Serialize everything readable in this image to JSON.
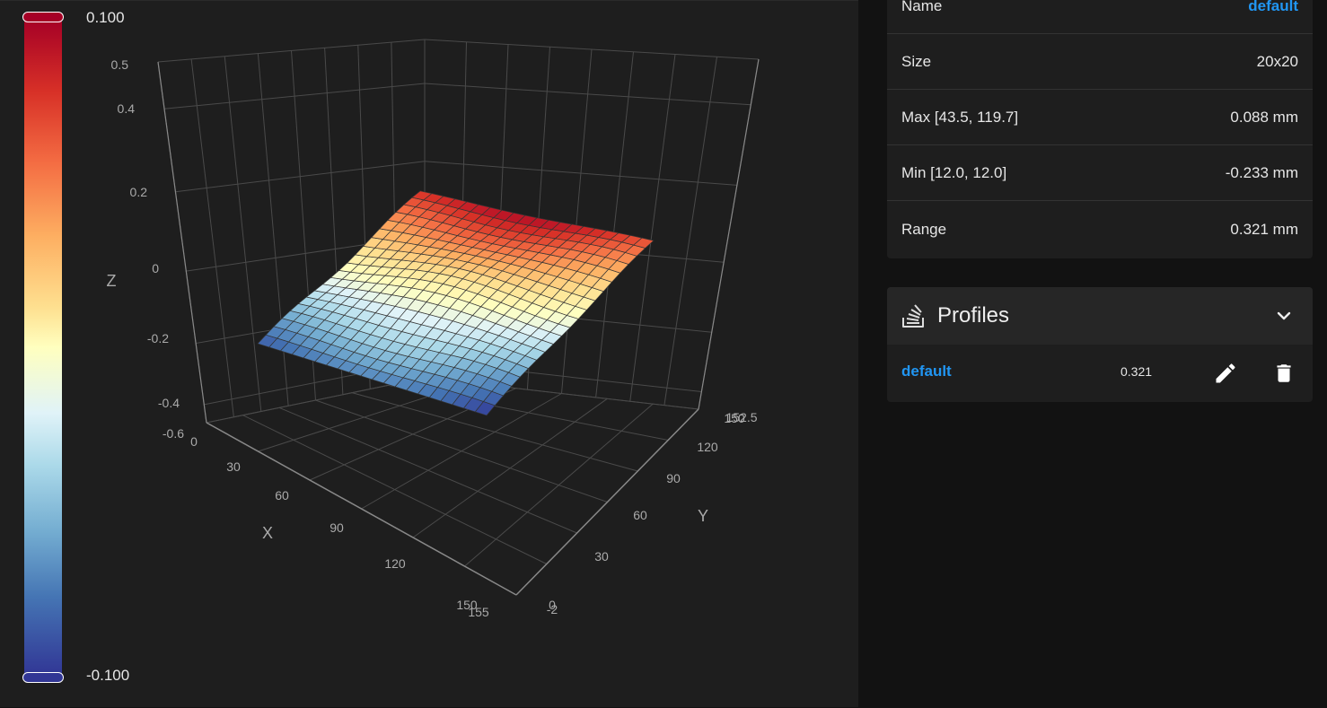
{
  "colorbar": {
    "max_label": "0.100",
    "min_label": "-0.100",
    "colors": [
      "#a50026",
      "#d73027",
      "#f46d43",
      "#fdae61",
      "#fee090",
      "#ffffbf",
      "#e0f3f8",
      "#abd9e9",
      "#74add1",
      "#4575b4",
      "#313695"
    ]
  },
  "plot": {
    "z_title": "Z",
    "x_title": "X",
    "y_title": "Y",
    "z_ticks": [
      "0.5",
      "0.4",
      "0.2",
      "0",
      "-0.2",
      "-0.4",
      "-0.6"
    ],
    "x_ticks": [
      "0",
      "30",
      "60",
      "90",
      "120",
      "150",
      "155"
    ],
    "y_ticks": [
      "0",
      "-2",
      "30",
      "60",
      "90",
      "120",
      "150",
      "152.5"
    ],
    "grid": true
  },
  "mesh_info": {
    "rows": [
      {
        "label": "Name",
        "value": "default",
        "is_link": true
      },
      {
        "label": "Size",
        "value": "20x20"
      },
      {
        "label": "Max [43.5, 119.7]",
        "value": "0.088 mm"
      },
      {
        "label": "Min [12.0, 12.0]",
        "value": "-0.233 mm"
      },
      {
        "label": "Range",
        "value": "0.321 mm"
      }
    ]
  },
  "profiles": {
    "title": "Profiles",
    "items": [
      {
        "name": "default",
        "range": "0.321"
      }
    ]
  },
  "icons": [
    "layers-icon",
    "chevron-down-icon",
    "pencil-icon",
    "trash-icon"
  ]
}
